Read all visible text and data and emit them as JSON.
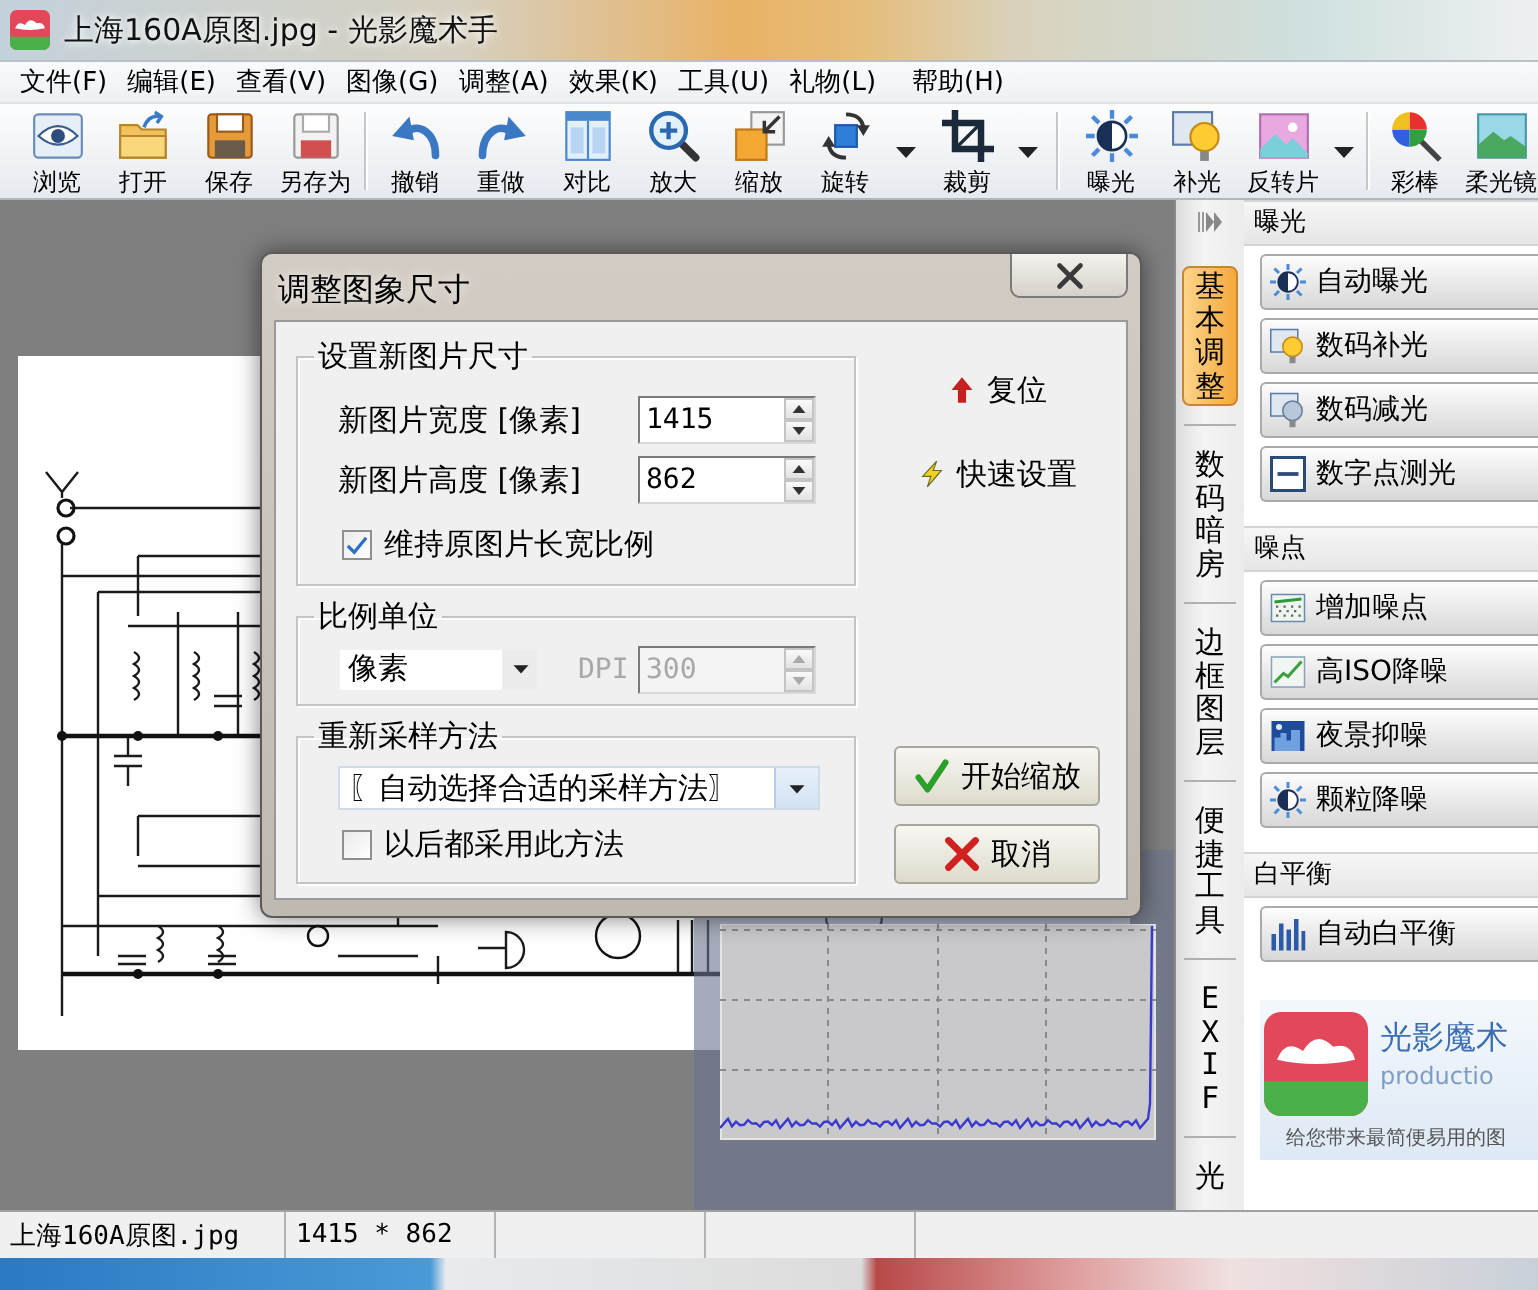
{
  "window": {
    "title": "上海160A原图.jpg - 光影魔术手"
  },
  "menu": [
    "文件(F)",
    "编辑(E)",
    "查看(V)",
    "图像(G)",
    "调整(A)",
    "效果(K)",
    "工具(U)",
    "礼物(L)",
    "帮助(H)"
  ],
  "toolbar": [
    [
      {
        "label": "浏览",
        "dropdown": false
      },
      {
        "label": "打开",
        "dropdown": false
      },
      {
        "label": "保存",
        "dropdown": false
      },
      {
        "label": "另存为",
        "dropdown": false
      }
    ],
    [
      {
        "label": "撤销",
        "dropdown": false
      },
      {
        "label": "重做",
        "dropdown": false
      },
      {
        "label": "对比",
        "dropdown": false
      },
      {
        "label": "放大",
        "dropdown": false
      },
      {
        "label": "缩放",
        "dropdown": false
      },
      {
        "label": "旋转",
        "dropdown": true
      },
      {
        "label": "裁剪",
        "dropdown": true
      }
    ],
    [
      {
        "label": "曝光",
        "dropdown": false
      },
      {
        "label": "补光",
        "dropdown": false
      },
      {
        "label": "反转片",
        "dropdown": true
      }
    ],
    [
      {
        "label": "彩棒",
        "dropdown": false
      },
      {
        "label": "柔光镜",
        "dropdown": false
      }
    ]
  ],
  "dialog": {
    "title": "调整图象尺寸",
    "size_group": {
      "title": "设置新图片尺寸",
      "fields": [
        {
          "label": "新图片宽度 [像素]",
          "value": "1415"
        },
        {
          "label": "新图片高度 [像素]",
          "value": "862"
        }
      ],
      "keep_ratio": {
        "label": "维持原图片长宽比例",
        "checked": true
      }
    },
    "links": [
      {
        "label": "复位",
        "kind": "reset"
      },
      {
        "label": "快速设置",
        "kind": "quick"
      }
    ],
    "unit_group": {
      "title": "比例单位",
      "unit": "像素",
      "dpi": {
        "label": "DPI",
        "value": "300",
        "disabled": true
      }
    },
    "resample_group": {
      "title": "重新采样方法",
      "method": "〖自动选择合适的采样方法〗",
      "remember": {
        "label": "以后都采用此方法",
        "checked": false
      }
    },
    "buttons": [
      {
        "label": "开始缩放",
        "kind": "ok"
      },
      {
        "label": "取消",
        "kind": "cancel"
      }
    ]
  },
  "side_tabs": [
    {
      "label": "基本调整",
      "selected": true
    },
    {
      "label": "数码暗房",
      "selected": false
    },
    {
      "label": "边框图层",
      "selected": false
    },
    {
      "label": "便捷工具",
      "selected": false
    },
    {
      "label": "EXIF",
      "selected": false
    },
    {
      "label": "光",
      "selected": false
    }
  ],
  "panel": [
    {
      "title": "曝光",
      "items": [
        "自动曝光",
        "数码补光",
        "数码减光",
        "数字点测光"
      ]
    },
    {
      "title": "噪点",
      "items": [
        "增加噪点",
        "高ISO降噪",
        "夜景抑噪",
        "颗粒降噪"
      ]
    },
    {
      "title": "白平衡",
      "items": [
        "自动白平衡"
      ]
    }
  ],
  "promo": {
    "title": "光影魔术",
    "subtitle": "productio",
    "tagline": "给您带来最简便易用的图"
  },
  "status_bar": [
    "上海160A原图.jpg",
    "1415 * 862"
  ]
}
